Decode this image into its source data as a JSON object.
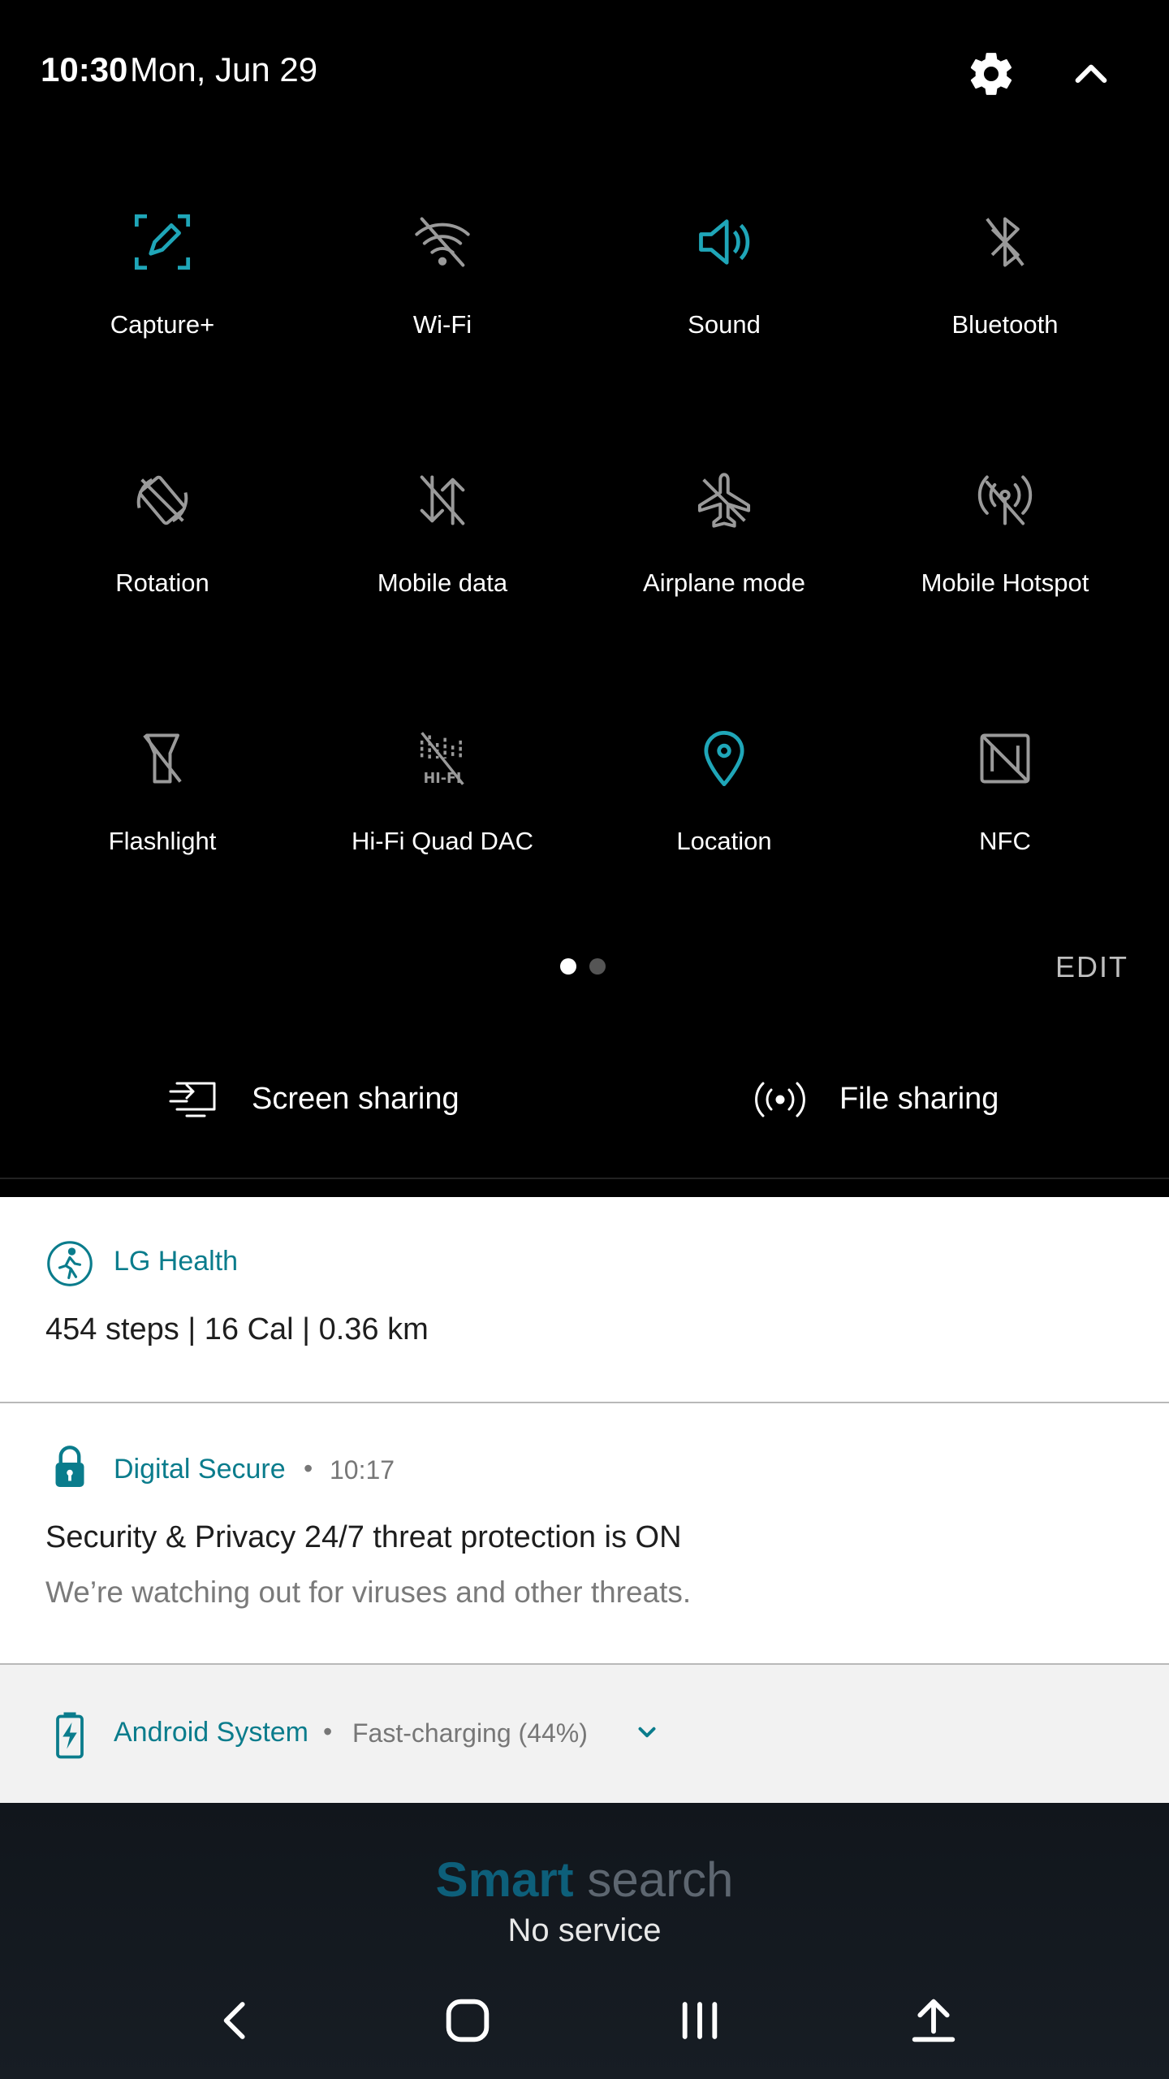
{
  "header": {
    "time": "10:30",
    "date": "Mon, Jun 29"
  },
  "colors": {
    "accent": "#1fa6b8",
    "inactive_icon": "#9a9a9a",
    "notif_app": "#0a7c8c"
  },
  "quick_settings": [
    {
      "label": "Capture+",
      "icon": "capture-plus-icon",
      "active": true
    },
    {
      "label": "Wi-Fi",
      "icon": "wifi-off-icon",
      "active": false
    },
    {
      "label": "Sound",
      "icon": "sound-icon",
      "active": true
    },
    {
      "label": "Bluetooth",
      "icon": "bluetooth-off-icon",
      "active": false
    },
    {
      "label": "Rotation",
      "icon": "rotation-off-icon",
      "active": false
    },
    {
      "label": "Mobile data",
      "icon": "mobile-data-off-icon",
      "active": false
    },
    {
      "label": "Airplane mode",
      "icon": "airplane-off-icon",
      "active": false
    },
    {
      "label": "Mobile Hotspot",
      "icon": "hotspot-off-icon",
      "active": false
    },
    {
      "label": "Flashlight",
      "icon": "flashlight-off-icon",
      "active": false
    },
    {
      "label": "Hi-Fi Quad DAC",
      "icon": "hifi-off-icon",
      "active": false
    },
    {
      "label": "Location",
      "icon": "location-icon",
      "active": true
    },
    {
      "label": "NFC",
      "icon": "nfc-off-icon",
      "active": false
    }
  ],
  "pager": {
    "pages": 2,
    "current": 1
  },
  "edit_label": "EDIT",
  "share": {
    "screen_label": "Screen sharing",
    "file_label": "File sharing"
  },
  "notifications": {
    "health": {
      "app": "LG Health",
      "body": "454 steps | 16 Cal | 0.36 km"
    },
    "secure": {
      "app": "Digital Secure",
      "time": "10:17",
      "title": "Security & Privacy 24/7 threat protection is ON",
      "text": "We’re watching out for viruses and other threats."
    },
    "system": {
      "app": "Android System",
      "status": "Fast-charging (44%)"
    }
  },
  "background": {
    "smart_word1": "Smart",
    "smart_word2": "search",
    "no_service": "No service"
  },
  "navbar": [
    "back-icon",
    "home-icon",
    "recents-icon",
    "upload-icon"
  ]
}
